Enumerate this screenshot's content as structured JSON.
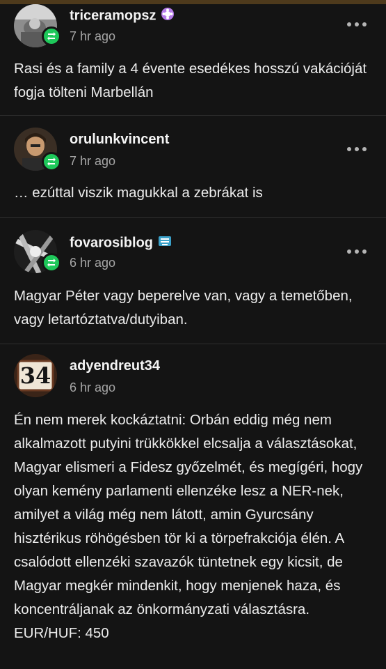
{
  "posts": [
    {
      "username": "triceramopsz",
      "time": "7 hr ago",
      "text": "Rasi és a family a 4 évente esedékes hosszú vakációját fogja tölteni Marbellán",
      "reblogged": true,
      "badge": "purple-flower-icon"
    },
    {
      "username": "orulunkvincent",
      "time": "7 hr ago",
      "text": "… ezúttal viszik magukkal a zebrákat is",
      "reblogged": true
    },
    {
      "username": "fovarosiblog",
      "time": "6 hr ago",
      "text": "Magyar Péter vagy beperelve van, vagy a temetőben, vagy letartóztatva/dutyiban.",
      "reblogged": true,
      "badge": "blue-badge-icon"
    },
    {
      "username": "adyendreut34",
      "time": "6 hr ago",
      "avatar_text": "34",
      "text": "Én nem merek kockáztatni: Orbán eddig még nem alkalmazott putyini trükkökkel elcsalja a választásokat, Magyar elismeri a Fidesz győzelmét, és megígéri, hogy olyan kemény parlamenti ellenzéke lesz a NER-nek, amilyet a világ még nem látott, amin Gyurcsány hisztérikus röhögésben tör ki a törpefrakciója élén. A csalódott ellenzéki szavazók tüntetnek egy kicsit, de Magyar megkér mindenkit, hogy menjenek haza, és koncentráljanak az önkormányzati választásra. EUR/HUF: 450",
      "reblogged": false
    }
  ],
  "colors": {
    "background": "#141414",
    "reblog_green": "#1ec85a",
    "muted": "#a6a6a6"
  }
}
